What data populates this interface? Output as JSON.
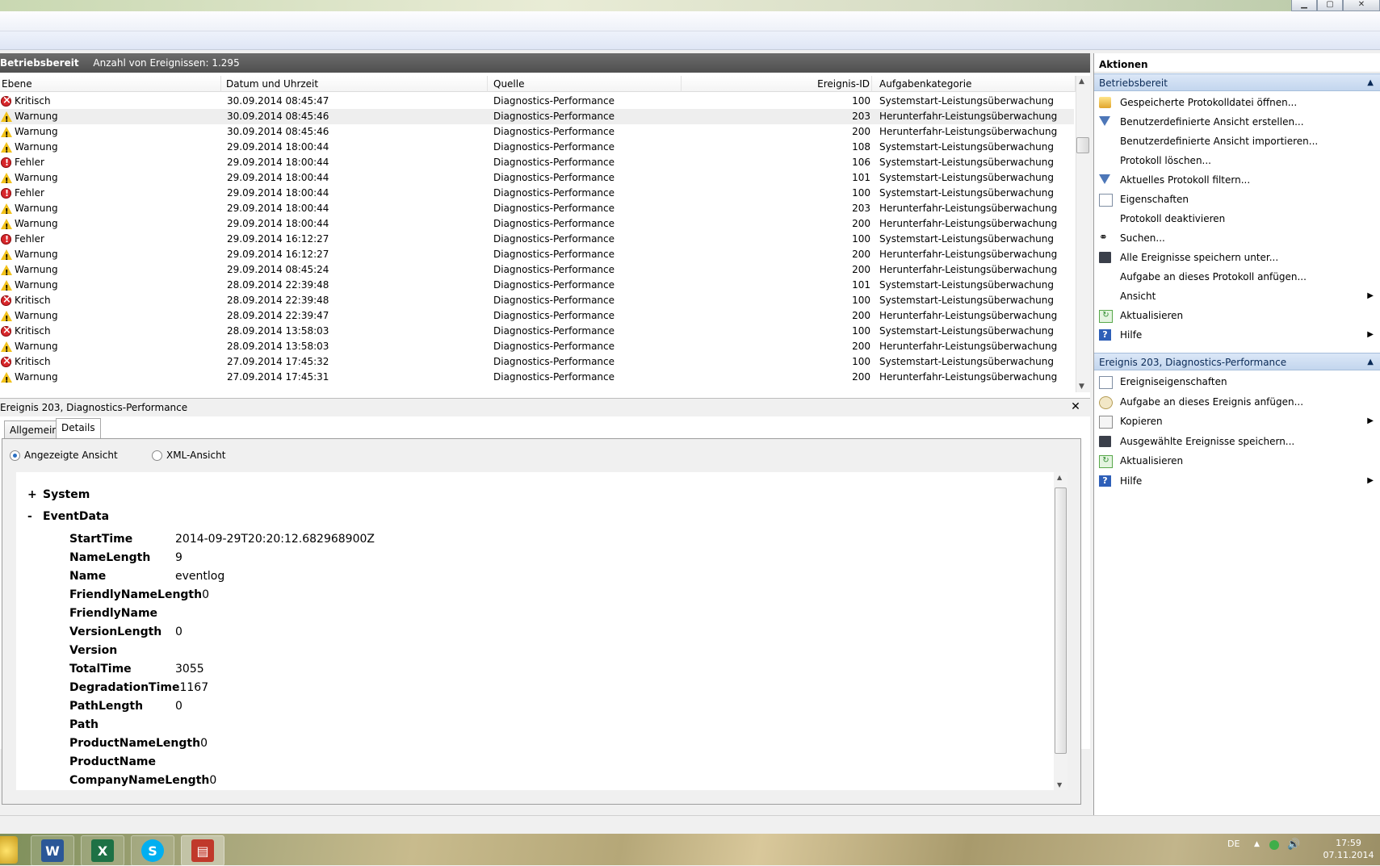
{
  "window": {
    "btn_min": "▁",
    "btn_max": "▢",
    "btn_close": "✕"
  },
  "log": {
    "title": "Betriebsbereit",
    "count": "Anzahl von Ereignissen: 1.295",
    "columns": [
      "Ebene",
      "Datum und Uhrzeit",
      "Quelle",
      "Ereignis-ID",
      "Aufgabenkategorie"
    ],
    "rows": [
      {
        "level": "Kritisch",
        "icon": "critical-icon",
        "date": "30.09.2014 08:45:47",
        "source": "Diagnostics-Performance",
        "id": "100",
        "cat": "Systemstart-Leistungsüberwachung"
      },
      {
        "level": "Warnung",
        "icon": "warning-icon",
        "date": "30.09.2014 08:45:46",
        "source": "Diagnostics-Performance",
        "id": "203",
        "cat": "Herunterfahr-Leistungsüberwachung"
      },
      {
        "level": "Warnung",
        "icon": "warning-icon",
        "date": "30.09.2014 08:45:46",
        "source": "Diagnostics-Performance",
        "id": "200",
        "cat": "Herunterfahr-Leistungsüberwachung"
      },
      {
        "level": "Warnung",
        "icon": "warning-icon",
        "date": "29.09.2014 18:00:44",
        "source": "Diagnostics-Performance",
        "id": "108",
        "cat": "Systemstart-Leistungsüberwachung"
      },
      {
        "level": "Fehler",
        "icon": "error-icon",
        "date": "29.09.2014 18:00:44",
        "source": "Diagnostics-Performance",
        "id": "106",
        "cat": "Systemstart-Leistungsüberwachung"
      },
      {
        "level": "Warnung",
        "icon": "warning-icon",
        "date": "29.09.2014 18:00:44",
        "source": "Diagnostics-Performance",
        "id": "101",
        "cat": "Systemstart-Leistungsüberwachung"
      },
      {
        "level": "Fehler",
        "icon": "error-icon",
        "date": "29.09.2014 18:00:44",
        "source": "Diagnostics-Performance",
        "id": "100",
        "cat": "Systemstart-Leistungsüberwachung"
      },
      {
        "level": "Warnung",
        "icon": "warning-icon",
        "date": "29.09.2014 18:00:44",
        "source": "Diagnostics-Performance",
        "id": "203",
        "cat": "Herunterfahr-Leistungsüberwachung"
      },
      {
        "level": "Warnung",
        "icon": "warning-icon",
        "date": "29.09.2014 18:00:44",
        "source": "Diagnostics-Performance",
        "id": "200",
        "cat": "Herunterfahr-Leistungsüberwachung"
      },
      {
        "level": "Fehler",
        "icon": "error-icon",
        "date": "29.09.2014 16:12:27",
        "source": "Diagnostics-Performance",
        "id": "100",
        "cat": "Systemstart-Leistungsüberwachung"
      },
      {
        "level": "Warnung",
        "icon": "warning-icon",
        "date": "29.09.2014 16:12:27",
        "source": "Diagnostics-Performance",
        "id": "200",
        "cat": "Herunterfahr-Leistungsüberwachung"
      },
      {
        "level": "Warnung",
        "icon": "warning-icon",
        "date": "29.09.2014 08:45:24",
        "source": "Diagnostics-Performance",
        "id": "200",
        "cat": "Herunterfahr-Leistungsüberwachung"
      },
      {
        "level": "Warnung",
        "icon": "warning-icon",
        "date": "28.09.2014 22:39:48",
        "source": "Diagnostics-Performance",
        "id": "101",
        "cat": "Systemstart-Leistungsüberwachung"
      },
      {
        "level": "Kritisch",
        "icon": "critical-icon",
        "date": "28.09.2014 22:39:48",
        "source": "Diagnostics-Performance",
        "id": "100",
        "cat": "Systemstart-Leistungsüberwachung"
      },
      {
        "level": "Warnung",
        "icon": "warning-icon",
        "date": "28.09.2014 22:39:47",
        "source": "Diagnostics-Performance",
        "id": "200",
        "cat": "Herunterfahr-Leistungsüberwachung"
      },
      {
        "level": "Kritisch",
        "icon": "critical-icon",
        "date": "28.09.2014 13:58:03",
        "source": "Diagnostics-Performance",
        "id": "100",
        "cat": "Systemstart-Leistungsüberwachung"
      },
      {
        "level": "Warnung",
        "icon": "warning-icon",
        "date": "28.09.2014 13:58:03",
        "source": "Diagnostics-Performance",
        "id": "200",
        "cat": "Herunterfahr-Leistungsüberwachung"
      },
      {
        "level": "Kritisch",
        "icon": "critical-icon",
        "date": "27.09.2014 17:45:32",
        "source": "Diagnostics-Performance",
        "id": "100",
        "cat": "Systemstart-Leistungsüberwachung"
      },
      {
        "level": "Warnung",
        "icon": "warning-icon",
        "date": "27.09.2014 17:45:31",
        "source": "Diagnostics-Performance",
        "id": "200",
        "cat": "Herunterfahr-Leistungsüberwachung"
      }
    ]
  },
  "detail": {
    "title": "Ereignis 203, Diagnostics-Performance",
    "close": "✕",
    "tabs": [
      "Allgemein",
      "Details"
    ],
    "radio_display": "Angezeigte Ansicht",
    "radio_xml": "XML-Ansicht",
    "system_toggle": "+",
    "system": "System",
    "eventdata_toggle": "-",
    "eventdata": "EventData",
    "fields": [
      {
        "k": "StartTime",
        "v": "2014-09-29T20:20:12.682968900Z"
      },
      {
        "k": "NameLength",
        "v": "9"
      },
      {
        "k": "Name",
        "v": "eventlog"
      },
      {
        "k": "FriendlyNameLength",
        "v": "0"
      },
      {
        "k": "FriendlyName",
        "v": ""
      },
      {
        "k": "VersionLength",
        "v": "0"
      },
      {
        "k": "Version",
        "v": ""
      },
      {
        "k": "TotalTime",
        "v": "3055"
      },
      {
        "k": "DegradationTime",
        "v": "1167"
      },
      {
        "k": "PathLength",
        "v": "0"
      },
      {
        "k": "Path",
        "v": ""
      },
      {
        "k": "ProductNameLength",
        "v": "0"
      },
      {
        "k": "ProductName",
        "v": ""
      },
      {
        "k": "CompanyNameLength",
        "v": "0"
      }
    ]
  },
  "actions": {
    "title": "Aktionen",
    "section1": "Betriebsbereit",
    "items1": [
      {
        "label": "Gespeicherte Protokolldatei öffnen...",
        "icon": "folder-icon"
      },
      {
        "label": "Benutzerdefinierte Ansicht erstellen...",
        "icon": "filter-icon"
      },
      {
        "label": "Benutzerdefinierte Ansicht importieren...",
        "icon": ""
      },
      {
        "label": "Protokoll löschen...",
        "icon": ""
      },
      {
        "label": "Aktuelles Protokoll filtern...",
        "icon": "filter-icon"
      },
      {
        "label": "Eigenschaften",
        "icon": "properties-icon"
      },
      {
        "label": "Protokoll deaktivieren",
        "icon": ""
      },
      {
        "label": "Suchen...",
        "icon": "binoculars-icon"
      },
      {
        "label": "Alle Ereignisse speichern unter...",
        "icon": "save-icon"
      },
      {
        "label": "Aufgabe an dieses Protokoll anfügen...",
        "icon": ""
      },
      {
        "label": "Ansicht",
        "icon": "",
        "sub": true
      },
      {
        "label": "Aktualisieren",
        "icon": "refresh-icon"
      },
      {
        "label": "Hilfe",
        "icon": "help-icon",
        "sub": true
      }
    ],
    "section2": "Ereignis 203, Diagnostics-Performance",
    "items2": [
      {
        "label": "Ereigniseigenschaften",
        "icon": "properties-icon"
      },
      {
        "label": "Aufgabe an dieses Ereignis anfügen...",
        "icon": "task-icon"
      },
      {
        "label": "Kopieren",
        "icon": "copy-icon",
        "sub": true
      },
      {
        "label": "Ausgewählte Ereignisse speichern...",
        "icon": "save-icon"
      },
      {
        "label": "Aktualisieren",
        "icon": "refresh-icon"
      },
      {
        "label": "Hilfe",
        "icon": "help-icon",
        "sub": true
      }
    ]
  },
  "taskbar": {
    "lang": "DE",
    "time": "17:59",
    "date": "07.11.2014"
  }
}
